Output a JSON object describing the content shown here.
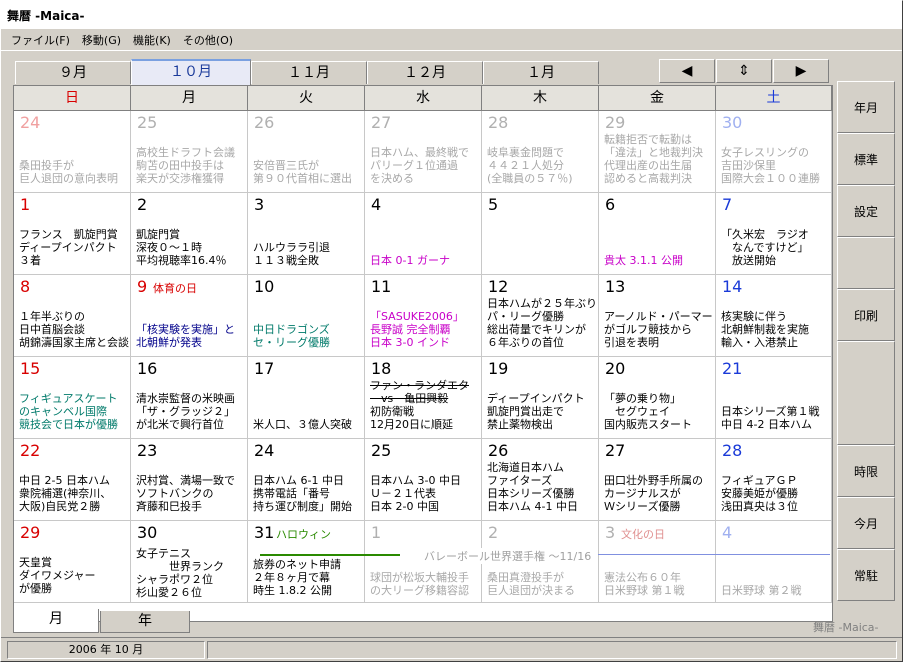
{
  "window": {
    "title": "舞暦 -Maica-"
  },
  "menu": [
    "ファイル(F)",
    "移動(G)",
    "機能(K)",
    "その他(O)"
  ],
  "month_tabs": [
    "９月",
    "１０月",
    "１１月",
    "１２月",
    "１月"
  ],
  "active_month_index": 1,
  "nav": {
    "prev": "◀",
    "updown": "⇕",
    "next": "▶"
  },
  "weekdays": [
    "日",
    "月",
    "火",
    "水",
    "木",
    "金",
    "土"
  ],
  "weeks": [
    [
      {
        "day": "24",
        "dim": true,
        "lines": [
          "桑田投手が",
          "巨人退団の意向表明"
        ]
      },
      {
        "day": "25",
        "dim": true,
        "lines": [
          "高校生ドラフト会議",
          "駒苫の田中投手は",
          "楽天が交渉権獲得"
        ]
      },
      {
        "day": "26",
        "dim": true,
        "lines": [
          "安倍晋三氏が",
          "第９０代首相に選出"
        ]
      },
      {
        "day": "27",
        "dim": true,
        "lines": [
          "日本ハム、最終戦で",
          "パリーグ１位通過",
          "を決める"
        ]
      },
      {
        "day": "28",
        "dim": true,
        "lines": [
          "岐阜裏金問題で",
          "４４２１人処分",
          "(全職員の５７％)"
        ]
      },
      {
        "day": "29",
        "dim": true,
        "lines": [
          "転籍拒否で転勤は",
          "「違法」と地裁判決",
          "代理出産の出生届",
          "認めると高裁判決"
        ]
      },
      {
        "day": "30",
        "dim": true,
        "lines": [
          "女子レスリングの",
          "吉田沙保里",
          "国際大会１００連勝"
        ]
      }
    ],
    [
      {
        "day": "1",
        "lines": [
          "フランス　凱旋門賞",
          "ディープインパクト",
          "３着"
        ]
      },
      {
        "day": "2",
        "lines": [
          "凱旋門賞",
          "深夜０～１時",
          "平均視聴率16.4％"
        ]
      },
      {
        "day": "3",
        "lines": [
          "ハルウララ引退",
          "１１３戦全敗"
        ]
      },
      {
        "day": "4",
        "lines": [
          "日本 0-1 ガーナ"
        ],
        "color": "mag"
      },
      {
        "day": "5",
        "lines": []
      },
      {
        "day": "6",
        "lines": [
          "貴太 3.1.1 公開"
        ],
        "color": "mag"
      },
      {
        "day": "7",
        "lines": [
          "「久米宏　ラジオ",
          "　なんですけど」",
          "　放送開始"
        ]
      }
    ],
    [
      {
        "day": "8",
        "lines": [
          "１年半ぶりの",
          "日中首脳会談",
          "胡錦濤国家主席と会談"
        ]
      },
      {
        "day": "9",
        "tag": "体育の日",
        "lines": [
          "「核実験を実施」と",
          "北朝鮮が発表"
        ],
        "color": "nav2"
      },
      {
        "day": "10",
        "lines": [
          "中日ドラゴンズ",
          "セ・リーグ優勝"
        ],
        "color": "grn"
      },
      {
        "day": "11",
        "lines": [
          "「SASUKE2006」",
          "長野誠 完全制覇",
          "日本 3-0 インド"
        ],
        "color": "mag"
      },
      {
        "day": "12",
        "lines": [
          "日本ハムが２５年ぶり",
          "パ・リーグ優勝",
          "総出荷量でキリンが",
          "６年ぶりの首位"
        ]
      },
      {
        "day": "13",
        "lines": [
          "アーノルド・パーマー",
          "がゴルフ競技から",
          "引退を表明"
        ]
      },
      {
        "day": "14",
        "lines": [
          "核実験に伴う",
          "北朝鮮制裁を実施",
          "輸入・入港禁止"
        ]
      }
    ],
    [
      {
        "day": "15",
        "lines": [
          "フィギュアスケート",
          "のキャンベル国際",
          "競技会で日本が優勝"
        ],
        "color": "grn"
      },
      {
        "day": "16",
        "lines": [
          "清水崇監督の米映画",
          "「ザ・グラッジ２」",
          "が北米で興行首位"
        ]
      },
      {
        "day": "17",
        "lines": [
          "米人口、３億人突破"
        ]
      },
      {
        "day": "18",
        "lines": [
          "ファン・ランダエタ",
          "　vs　亀田興毅",
          "初防衛戦",
          "12月20日に順延"
        ]
      },
      {
        "day": "19",
        "lines": [
          "ディープインパクト",
          "凱旋門賞出走で",
          "禁止薬物検出"
        ]
      },
      {
        "day": "20",
        "lines": [
          "「夢の乗り物」",
          "　セグウェイ",
          "国内販売スタート"
        ]
      },
      {
        "day": "21",
        "lines": [
          "日本シリーズ第１戦",
          "中日 4-2 日本ハム"
        ]
      }
    ],
    [
      {
        "day": "22",
        "lines": [
          "中日 2-5 日本ハム",
          "衆院補選(神奈川、",
          "大阪)自民党２勝"
        ]
      },
      {
        "day": "23",
        "lines": [
          "沢村賞、満場一致で",
          "ソフトバンクの",
          "斉藤和巳投手"
        ]
      },
      {
        "day": "24",
        "lines": [
          "日本ハム 6-1 中日",
          "携帯電話「番号",
          "持ち運び制度」開始"
        ]
      },
      {
        "day": "25",
        "lines": [
          "日本ハム 3-0 中日",
          "Ｕ－２１代表",
          "日本 2-0 中国"
        ]
      },
      {
        "day": "26",
        "lines": [
          "北海道日本ハム",
          "ファイターズ",
          "日本シリーズ優勝",
          "日本ハム 4-1 中日"
        ]
      },
      {
        "day": "27",
        "lines": [
          "田口壮外野手所属の",
          "カージナルスが",
          "Ｗシリーズ優勝"
        ]
      },
      {
        "day": "28",
        "lines": [
          "フィギュアＧＰ",
          "安藤美姫が優勝",
          "浅田真央は３位"
        ]
      }
    ],
    [
      {
        "day": "29",
        "lines": [
          "天皇賞",
          "ダイワメジャー",
          "が優勝"
        ]
      },
      {
        "day": "30",
        "lines": [
          "女子テニス",
          "　　　世界ランク",
          "シャラポワ２位",
          "杉山愛２６位"
        ]
      },
      {
        "day": "31",
        "tag": "ハロウィン",
        "lines": [
          "旅券のネット申請",
          "２年８ヶ月で幕",
          "時生 1.8.2 公開"
        ]
      },
      {
        "day": "1",
        "dim": true,
        "lines": [
          "球団が松坂大輔投手",
          "の大リーグ移籍容認"
        ]
      },
      {
        "day": "2",
        "dim": true,
        "lines": [
          "桑田真澄投手が",
          "巨人退団が決まる"
        ]
      },
      {
        "day": "3",
        "dim": true,
        "tag": "文化の日",
        "lines": [
          "憲法公布６０年",
          "日米野球 第１戦"
        ]
      },
      {
        "day": "4",
        "dim": true,
        "lines": [
          "日米野球 第２戦"
        ]
      }
    ]
  ],
  "span_event": "バレーボール世界選手権 ～11/16",
  "sidebar": [
    "年月",
    "標準",
    "設定",
    "",
    "印刷",
    "",
    "時限",
    "今月",
    "常駐"
  ],
  "bottom_tabs": [
    "月",
    "年"
  ],
  "app_name": "舞暦 -Maica-",
  "status": {
    "date": "2006 年 10 月"
  }
}
